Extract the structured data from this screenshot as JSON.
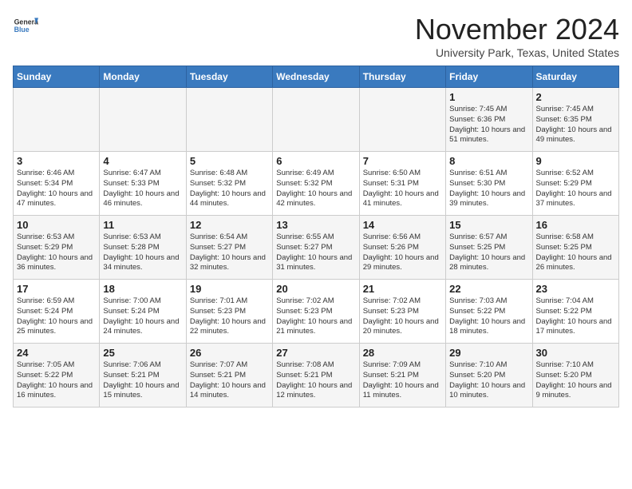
{
  "header": {
    "logo_general": "General",
    "logo_blue": "Blue",
    "month_title": "November 2024",
    "location": "University Park, Texas, United States"
  },
  "weekdays": [
    "Sunday",
    "Monday",
    "Tuesday",
    "Wednesday",
    "Thursday",
    "Friday",
    "Saturday"
  ],
  "weeks": [
    [
      {
        "day": "",
        "info": ""
      },
      {
        "day": "",
        "info": ""
      },
      {
        "day": "",
        "info": ""
      },
      {
        "day": "",
        "info": ""
      },
      {
        "day": "",
        "info": ""
      },
      {
        "day": "1",
        "info": "Sunrise: 7:45 AM\nSunset: 6:36 PM\nDaylight: 10 hours\nand 51 minutes."
      },
      {
        "day": "2",
        "info": "Sunrise: 7:45 AM\nSunset: 6:35 PM\nDaylight: 10 hours\nand 49 minutes."
      }
    ],
    [
      {
        "day": "3",
        "info": "Sunrise: 6:46 AM\nSunset: 5:34 PM\nDaylight: 10 hours\nand 47 minutes."
      },
      {
        "day": "4",
        "info": "Sunrise: 6:47 AM\nSunset: 5:33 PM\nDaylight: 10 hours\nand 46 minutes."
      },
      {
        "day": "5",
        "info": "Sunrise: 6:48 AM\nSunset: 5:32 PM\nDaylight: 10 hours\nand 44 minutes."
      },
      {
        "day": "6",
        "info": "Sunrise: 6:49 AM\nSunset: 5:32 PM\nDaylight: 10 hours\nand 42 minutes."
      },
      {
        "day": "7",
        "info": "Sunrise: 6:50 AM\nSunset: 5:31 PM\nDaylight: 10 hours\nand 41 minutes."
      },
      {
        "day": "8",
        "info": "Sunrise: 6:51 AM\nSunset: 5:30 PM\nDaylight: 10 hours\nand 39 minutes."
      },
      {
        "day": "9",
        "info": "Sunrise: 6:52 AM\nSunset: 5:29 PM\nDaylight: 10 hours\nand 37 minutes."
      }
    ],
    [
      {
        "day": "10",
        "info": "Sunrise: 6:53 AM\nSunset: 5:29 PM\nDaylight: 10 hours\nand 36 minutes."
      },
      {
        "day": "11",
        "info": "Sunrise: 6:53 AM\nSunset: 5:28 PM\nDaylight: 10 hours\nand 34 minutes."
      },
      {
        "day": "12",
        "info": "Sunrise: 6:54 AM\nSunset: 5:27 PM\nDaylight: 10 hours\nand 32 minutes."
      },
      {
        "day": "13",
        "info": "Sunrise: 6:55 AM\nSunset: 5:27 PM\nDaylight: 10 hours\nand 31 minutes."
      },
      {
        "day": "14",
        "info": "Sunrise: 6:56 AM\nSunset: 5:26 PM\nDaylight: 10 hours\nand 29 minutes."
      },
      {
        "day": "15",
        "info": "Sunrise: 6:57 AM\nSunset: 5:25 PM\nDaylight: 10 hours\nand 28 minutes."
      },
      {
        "day": "16",
        "info": "Sunrise: 6:58 AM\nSunset: 5:25 PM\nDaylight: 10 hours\nand 26 minutes."
      }
    ],
    [
      {
        "day": "17",
        "info": "Sunrise: 6:59 AM\nSunset: 5:24 PM\nDaylight: 10 hours\nand 25 minutes."
      },
      {
        "day": "18",
        "info": "Sunrise: 7:00 AM\nSunset: 5:24 PM\nDaylight: 10 hours\nand 24 minutes."
      },
      {
        "day": "19",
        "info": "Sunrise: 7:01 AM\nSunset: 5:23 PM\nDaylight: 10 hours\nand 22 minutes."
      },
      {
        "day": "20",
        "info": "Sunrise: 7:02 AM\nSunset: 5:23 PM\nDaylight: 10 hours\nand 21 minutes."
      },
      {
        "day": "21",
        "info": "Sunrise: 7:02 AM\nSunset: 5:23 PM\nDaylight: 10 hours\nand 20 minutes."
      },
      {
        "day": "22",
        "info": "Sunrise: 7:03 AM\nSunset: 5:22 PM\nDaylight: 10 hours\nand 18 minutes."
      },
      {
        "day": "23",
        "info": "Sunrise: 7:04 AM\nSunset: 5:22 PM\nDaylight: 10 hours\nand 17 minutes."
      }
    ],
    [
      {
        "day": "24",
        "info": "Sunrise: 7:05 AM\nSunset: 5:22 PM\nDaylight: 10 hours\nand 16 minutes."
      },
      {
        "day": "25",
        "info": "Sunrise: 7:06 AM\nSunset: 5:21 PM\nDaylight: 10 hours\nand 15 minutes."
      },
      {
        "day": "26",
        "info": "Sunrise: 7:07 AM\nSunset: 5:21 PM\nDaylight: 10 hours\nand 14 minutes."
      },
      {
        "day": "27",
        "info": "Sunrise: 7:08 AM\nSunset: 5:21 PM\nDaylight: 10 hours\nand 12 minutes."
      },
      {
        "day": "28",
        "info": "Sunrise: 7:09 AM\nSunset: 5:21 PM\nDaylight: 10 hours\nand 11 minutes."
      },
      {
        "day": "29",
        "info": "Sunrise: 7:10 AM\nSunset: 5:20 PM\nDaylight: 10 hours\nand 10 minutes."
      },
      {
        "day": "30",
        "info": "Sunrise: 7:10 AM\nSunset: 5:20 PM\nDaylight: 10 hours\nand 9 minutes."
      }
    ]
  ]
}
